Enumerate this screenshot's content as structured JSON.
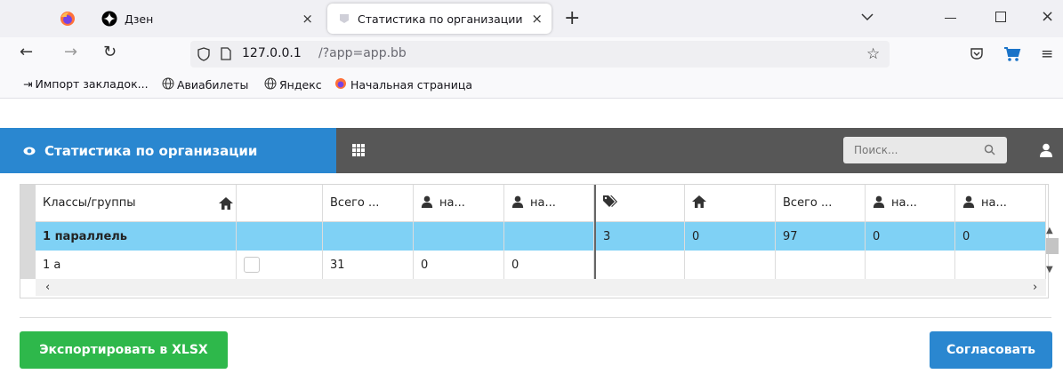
{
  "browser": {
    "tabs": [
      {
        "label": "Дзен"
      },
      {
        "label": "Статистика по организации"
      }
    ],
    "url_host": "127.0.0.1",
    "url_path": "/?app=app.bb",
    "bookmarks": [
      {
        "label": "Импорт закладок..."
      },
      {
        "label": "Авиабилеты"
      },
      {
        "label": "Яндекс"
      },
      {
        "label": "Начальная страница"
      }
    ]
  },
  "app": {
    "title": "Статистика по организации",
    "search_placeholder": "Поиск...",
    "colors": {
      "accent": "#2a87d0",
      "row_highlight": "#7fd1f5",
      "export": "#2eb84b",
      "approve": "#2a87d0"
    }
  },
  "table": {
    "headers": [
      "Классы/группы",
      "",
      "Всего ...",
      "на...",
      "на...",
      "",
      "",
      "Всего ...",
      "на...",
      "на..."
    ],
    "rows": [
      {
        "cells": [
          "1 параллель",
          "",
          "",
          "",
          "",
          "3",
          "0",
          "97",
          "0",
          "0"
        ]
      },
      {
        "cells": [
          "1 а",
          "",
          "31",
          "0",
          "0",
          "",
          "",
          "",
          "",
          ""
        ]
      }
    ]
  },
  "actions": {
    "export_label": "Экспортировать в XLSX",
    "approve_label": "Согласовать"
  }
}
